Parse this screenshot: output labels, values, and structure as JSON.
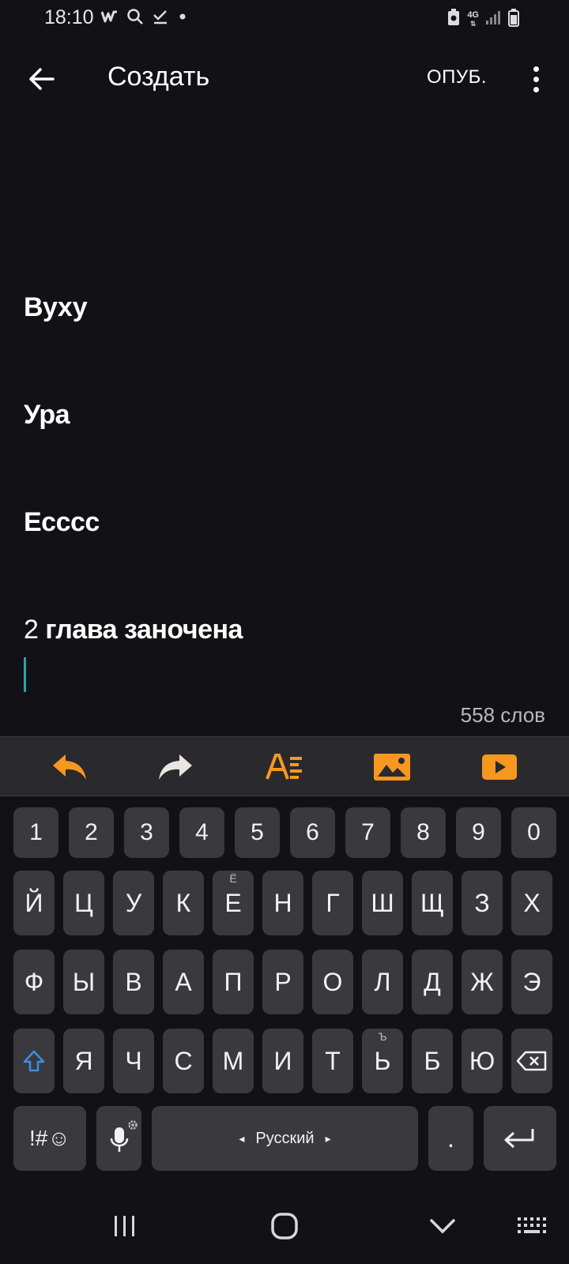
{
  "status_bar": {
    "time": "18:10",
    "network": "4G"
  },
  "app_bar": {
    "title": "Создать",
    "publish_label": "ОПУБ."
  },
  "editor": {
    "paragraphs": [
      "Вуху",
      "Ура",
      "Еcccc"
    ],
    "last_line_number": "2",
    "last_line_text": "глава заночена",
    "word_count": "558 слов"
  },
  "toolbar": {
    "accent_color": "#f6981f",
    "buttons": [
      "undo-icon",
      "redo-icon",
      "text-format-icon",
      "image-icon",
      "video-icon"
    ]
  },
  "keyboard": {
    "numbers": [
      "1",
      "2",
      "3",
      "4",
      "5",
      "6",
      "7",
      "8",
      "9",
      "0"
    ],
    "row1": [
      "Й",
      "Ц",
      "У",
      "К",
      "Е",
      "Н",
      "Г",
      "Ш",
      "Щ",
      "З",
      "Х"
    ],
    "row1_sub_e": "Ё",
    "row2": [
      "Ф",
      "Ы",
      "В",
      "А",
      "П",
      "Р",
      "О",
      "Л",
      "Д",
      "Ж",
      "Э"
    ],
    "row3": [
      "Я",
      "Ч",
      "С",
      "М",
      "И",
      "Т",
      "Ь",
      "Б",
      "Ю"
    ],
    "row3_sub_soft": "Ъ",
    "symbols_label": "!#☺",
    "language_label": "Русский",
    "period_label": ".",
    "shift_color": "#3a8ee6"
  }
}
